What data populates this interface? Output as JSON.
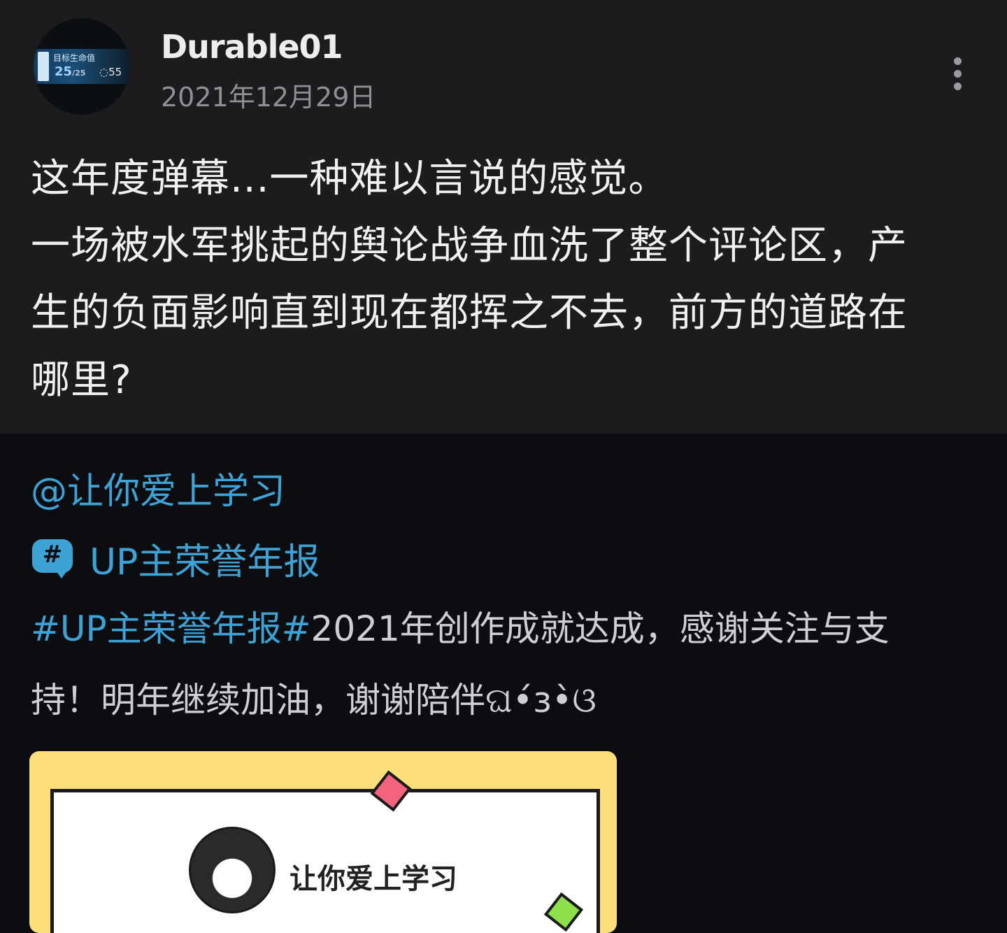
{
  "post": {
    "username": "Durable01",
    "date": "2021年12月29日",
    "avatar": {
      "hud_label": "目标生命值",
      "hud_hp": "25",
      "hud_hp_max": "/25",
      "hud_shield": "◌55"
    },
    "text_lines": [
      "这年度弹幕...一种难以言说的感觉。",
      "一场被水军挑起的舆论战争血洗了整个评论区，产",
      "生的负面影响直到现在都挥之不去，前方的道路在",
      "哪里?"
    ]
  },
  "repost": {
    "mention": "@让你爱上学习",
    "topic_label": "UP主荣誉年报",
    "topic_icon_glyph": "#",
    "text_tag": "#UP主荣誉年报#",
    "text_line1_rest": "2021年创作成就达成，感谢关注与支",
    "text_line2": "持！明年继续加油，谢谢陪伴ଘ•́з•̀ଓ",
    "card": {
      "name": "让你爱上学习"
    }
  },
  "colors": {
    "accent": "#3fa2d4",
    "post_bg": "#1c1c1e",
    "page_bg": "#0c0d10",
    "card_bg": "#fde07c"
  }
}
